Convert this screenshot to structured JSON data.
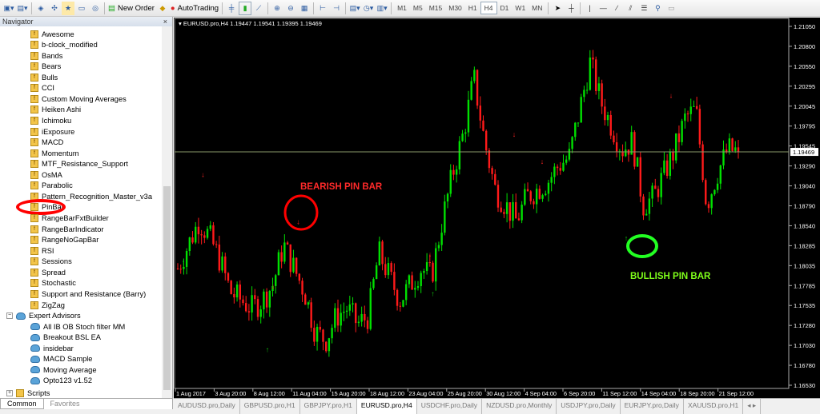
{
  "toolbar": {
    "new_order": "New Order",
    "autotrading": "AutoTrading",
    "timeframes": [
      "M1",
      "M5",
      "M15",
      "M30",
      "H1",
      "H4",
      "D1",
      "W1",
      "MN"
    ],
    "active_timeframe": "H4"
  },
  "navigator": {
    "title": "Navigator",
    "close": "×",
    "indicators": [
      "Awesome",
      "b-clock_modified",
      "Bands",
      "Bears",
      "Bulls",
      "CCI",
      "Custom Moving Averages",
      "Heiken Ashi",
      "Ichimoku",
      "iExposure",
      "MACD",
      "Momentum",
      "MTF_Resistance_Support",
      "OsMA",
      "Parabolic",
      "Pattern_Recognition_Master_v3a",
      "PinBar",
      "RangeBarFxtBuilder",
      "RangeBarIndicator",
      "RangeNoGapBar",
      "RSI",
      "Sessions",
      "Spread",
      "Stochastic",
      "Support and Resistance (Barry)",
      "ZigZag"
    ],
    "highlighted": "PinBar",
    "expert_advisors_label": "Expert Advisors",
    "expert_advisors": [
      "All IB OB Stoch filter MM",
      "Breakout BSL EA",
      "insidebar",
      "MACD Sample",
      "Moving Average",
      "Opto123 v1.52"
    ],
    "scripts_label": "Scripts",
    "tabs": [
      "Common",
      "Favorites"
    ]
  },
  "chart": {
    "title": "EURUSD.pro,H4  1.19447 1.19541 1.19395 1.19469"
  },
  "chart_data": {
    "type": "candlestick",
    "symbol": "EURUSD.pro",
    "timeframe": "H4",
    "ylim": [
      1.1653,
      1.2105
    ],
    "price_ticks": [
      "1.21050",
      "1.20800",
      "1.20550",
      "1.20295",
      "1.20045",
      "1.19795",
      "1.19545",
      "1.19290",
      "1.19040",
      "1.18790",
      "1.18540",
      "1.18285",
      "1.18035",
      "1.17785",
      "1.17535",
      "1.17280",
      "1.17030",
      "1.16780",
      "1.16530"
    ],
    "current_price": "1.19469",
    "time_ticks": [
      "1 Aug 2017",
      "3 Aug 20:00",
      "8 Aug 12:00",
      "11 Aug 04:00",
      "15 Aug 20:00",
      "18 Aug 12:00",
      "23 Aug 04:00",
      "25 Aug 20:00",
      "30 Aug 12:00",
      "4 Sep 04:00",
      "6 Sep 20:00",
      "11 Sep 12:00",
      "14 Sep 04:00",
      "18 Sep 20:00",
      "21 Sep 12:00"
    ],
    "close_path": [
      1.18,
      1.183,
      1.186,
      1.184,
      1.181,
      1.177,
      1.176,
      1.175,
      1.176,
      1.178,
      1.183,
      1.18,
      1.177,
      1.172,
      1.171,
      1.174,
      1.175,
      1.173,
      1.174,
      1.182,
      1.179,
      1.176,
      1.178,
      1.18,
      1.179,
      1.186,
      1.192,
      1.197,
      1.204,
      1.196,
      1.19,
      1.188,
      1.186,
      1.189,
      1.19,
      1.191,
      1.193,
      1.194,
      1.2,
      1.206,
      1.201,
      1.198,
      1.195,
      1.196,
      1.188,
      1.189,
      1.192,
      1.195,
      1.199,
      1.2,
      1.188,
      1.192,
      1.195,
      1.1947
    ],
    "colors": {
      "bull": "#00e000",
      "bear": "#ff1a1a",
      "price_line": "#8a9a6a"
    },
    "sell_signals": [
      [
        0.045,
        1.1915
      ],
      [
        0.17,
        1.1775
      ],
      [
        0.215,
        1.1856
      ],
      [
        0.45,
        1.1815
      ],
      [
        0.6,
        1.1966
      ],
      [
        0.65,
        1.1932
      ],
      [
        0.88,
        1.2015
      ]
    ],
    "buy_signals": [
      [
        0.01,
        1.1805
      ],
      [
        0.16,
        1.1695
      ],
      [
        0.235,
        1.1755
      ],
      [
        0.455,
        1.1765
      ],
      [
        0.8,
        1.1835
      ]
    ],
    "annotations": {
      "bearish": "BEARISH PIN BAR",
      "bullish": "BULLISH PIN BAR"
    }
  },
  "chart_tabs": [
    "AUDUSD.pro,Daily",
    "GBPUSD.pro,H1",
    "GBPJPY.pro,H1",
    "EURUSD.pro,H4",
    "USDCHF.pro,Daily",
    "NZDUSD.pro,Monthly",
    "USDJPY.pro,Daily",
    "EURJPY.pro,Daily",
    "XAUUSD.pro,H1"
  ],
  "active_chart_tab": "EURUSD.pro,H4"
}
